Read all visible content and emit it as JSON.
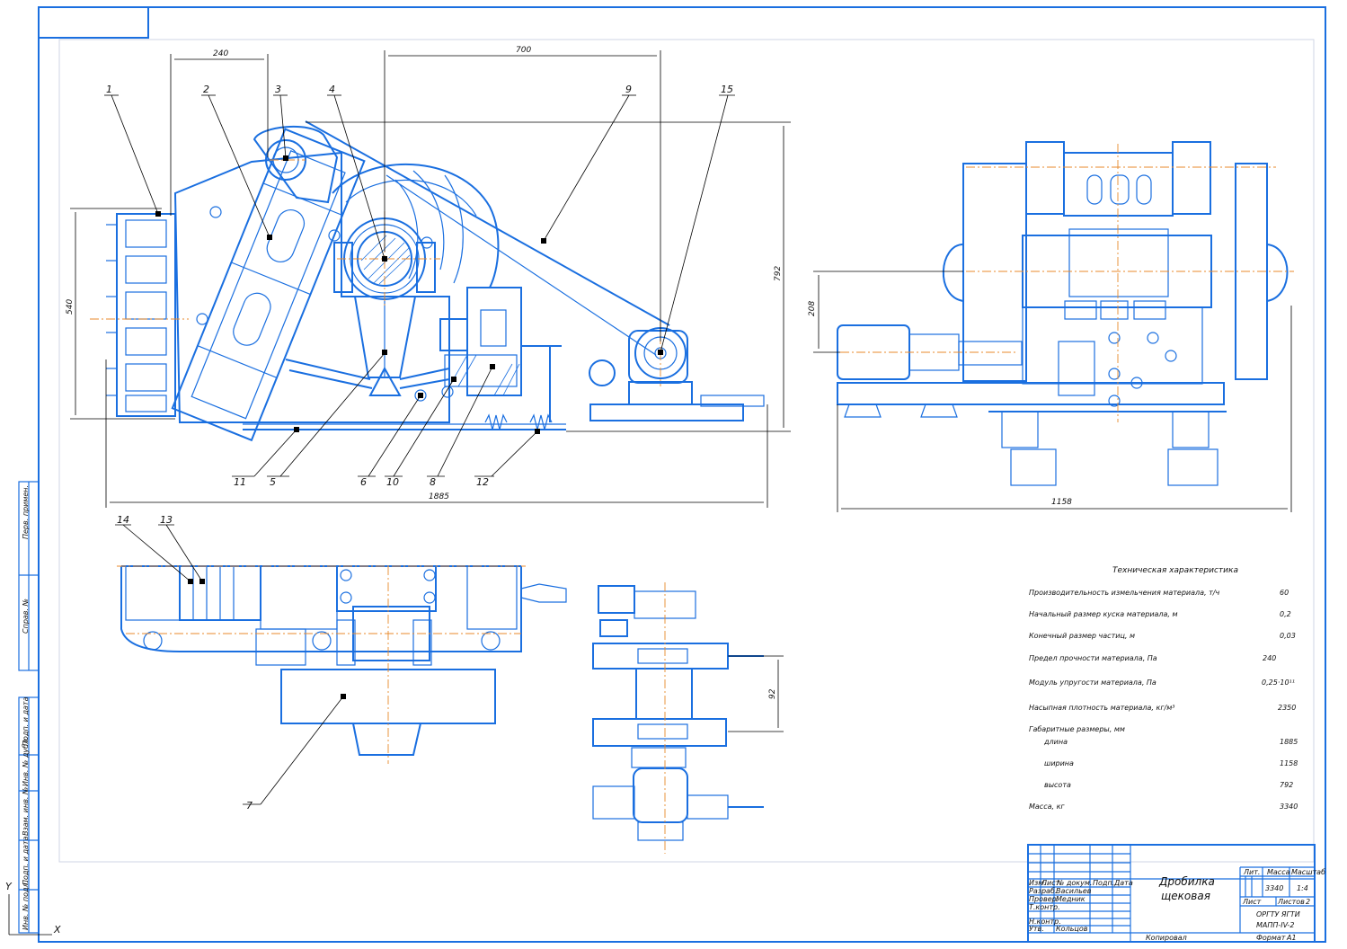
{
  "sheet": {
    "title_line1": "Дробилка",
    "title_line2": "щековая",
    "scale": "1:4",
    "mass": "3340",
    "organization_line1": "ОРГТУ ЯГТИ",
    "organization_line2": "МАПП-IV-2",
    "format_label": "Формат",
    "format_value": "A1",
    "copied_label": "Копировал",
    "sheet_label": "Лист",
    "sheets_label": "Листов",
    "sheets_count": "2",
    "col_lit": "Лит.",
    "col_mass": "Масса",
    "col_scale": "Масштаб",
    "row_labels": [
      "Изм.",
      "Лист",
      "№ докум.",
      "Подп.",
      "Дата"
    ],
    "roles": [
      "Разраб.",
      "Провер.",
      "Т.контр.",
      "",
      "Н.контр.",
      "Утв."
    ],
    "names": [
      "Васильев",
      "Медник",
      "",
      "",
      "",
      "Кольцов"
    ]
  },
  "side_stamps": [
    "Перв. примен.",
    "Справ. №",
    "Подп. и дата",
    "Инв. № дубл.",
    "Взам. инв. №",
    "Подп. и дата",
    "Инв. № подл."
  ],
  "dimensions": {
    "d240": "240",
    "d700": "700",
    "d540": "540",
    "d792": "792",
    "d1885": "1885",
    "d1158": "1158",
    "d208": "208",
    "d92": "92"
  },
  "leaders": [
    "1",
    "2",
    "3",
    "4",
    "5",
    "6",
    "7",
    "8",
    "9",
    "10",
    "11",
    "12",
    "13",
    "14",
    "15"
  ],
  "specs": {
    "heading": "Техническая характеристика",
    "rows": [
      {
        "label": "Производительность измельчения материала, т/ч",
        "value": "60"
      },
      {
        "label": "Начальный размер куска материала, м",
        "value": "0,2"
      },
      {
        "label": "Конечный размер частиц, м",
        "value": "0,03"
      },
      {
        "label": "Предел прочности материала, Па",
        "value": "240"
      },
      {
        "label": "Модуль упругости материала, Па",
        "value": "0,25·10¹¹"
      },
      {
        "label": "Насыпная плотность материала, кг/м³",
        "value": "2350"
      },
      {
        "label": "Габаритные размеры, мм",
        "value": ""
      },
      {
        "label": "длина",
        "value": "1885"
      },
      {
        "label": "ширина",
        "value": "1158"
      },
      {
        "label": "высота",
        "value": "792"
      },
      {
        "label": "Масса, кг",
        "value": "3340"
      }
    ]
  },
  "axis_marks": {
    "x": "X",
    "y": "Y"
  },
  "colors": {
    "line": "#1a6fe0",
    "center": "#e8892b",
    "dim": "#000000"
  }
}
